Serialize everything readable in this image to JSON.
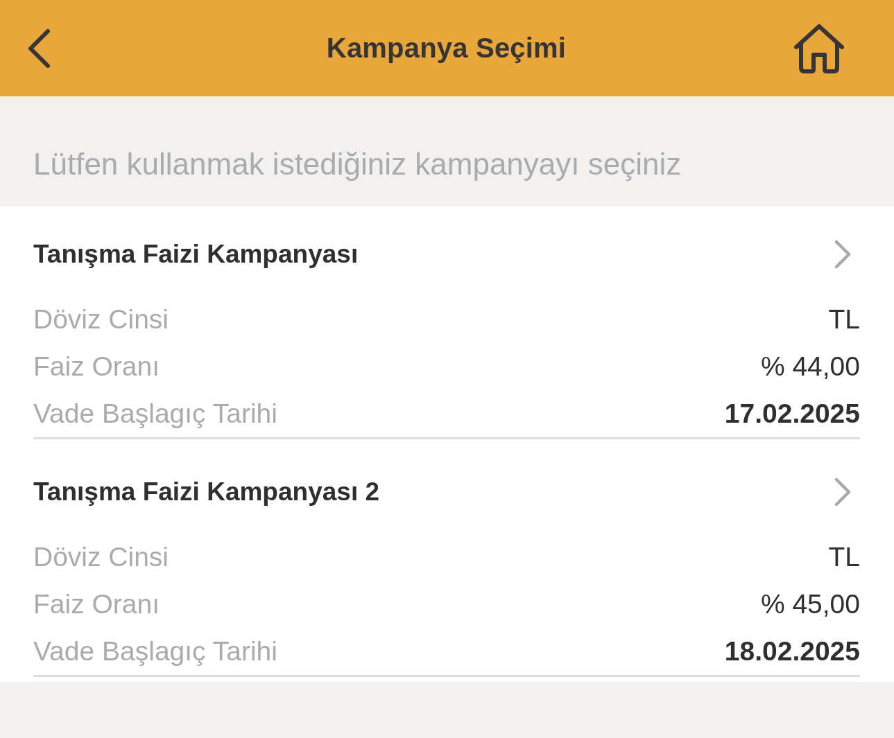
{
  "header": {
    "title": "Kampanya Seçimi"
  },
  "instruction": "Lütfen kullanmak istediğiniz kampanyayı seçiniz",
  "campaigns": [
    {
      "title": "Tanışma Faizi Kampanyası",
      "details": [
        {
          "label": "Döviz Cinsi",
          "value": "TL",
          "emphasized": false
        },
        {
          "label": "Faiz Oranı",
          "value": "% 44,00",
          "emphasized": false
        },
        {
          "label": "Vade Başlagıç Tarihi",
          "value": "17.02.2025",
          "emphasized": true
        }
      ]
    },
    {
      "title": "Tanışma Faizi Kampanyası 2",
      "details": [
        {
          "label": "Döviz Cinsi",
          "value": "TL",
          "emphasized": false
        },
        {
          "label": "Faiz Oranı",
          "value": "% 45,00",
          "emphasized": false
        },
        {
          "label": "Vade Başlagıç Tarihi",
          "value": "18.02.2025",
          "emphasized": true
        }
      ]
    }
  ]
}
